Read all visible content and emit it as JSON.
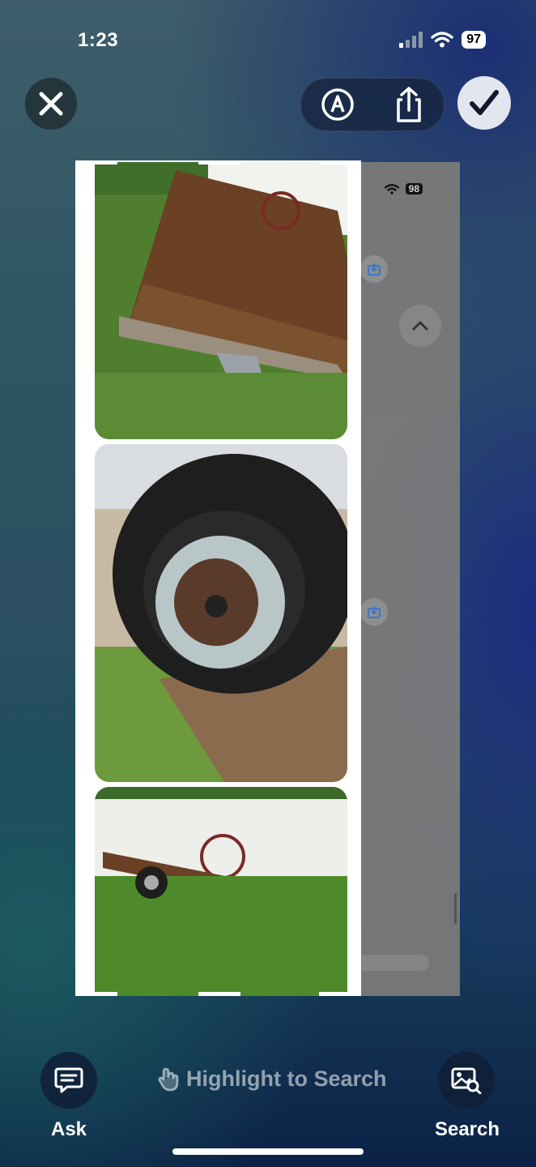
{
  "status_bar": {
    "time": "1:23",
    "battery": "97"
  },
  "background_screen": {
    "battery": "98"
  },
  "toolbar": {
    "close_icon": "close-icon",
    "markup_icon": "markup-pen-icon",
    "share_icon": "share-icon",
    "done_icon": "checkmark-icon"
  },
  "bottom_bar": {
    "ask_label": "Ask",
    "highlight_hint": "Highlight to Search",
    "search_label": "Search"
  }
}
